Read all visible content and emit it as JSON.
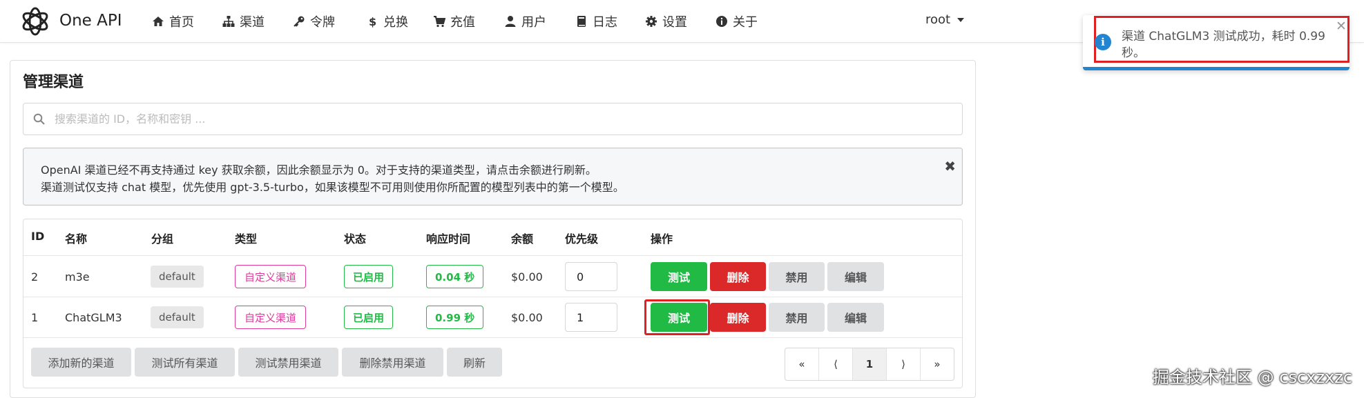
{
  "brand": {
    "name": "One API"
  },
  "nav": {
    "items": [
      {
        "label": "首页",
        "icon": "home-icon"
      },
      {
        "label": "渠道",
        "icon": "sitemap-icon"
      },
      {
        "label": "令牌",
        "icon": "key-icon"
      },
      {
        "label": "兑换",
        "icon": "dollar-icon"
      },
      {
        "label": "充值",
        "icon": "cart-icon"
      },
      {
        "label": "用户",
        "icon": "user-icon"
      },
      {
        "label": "日志",
        "icon": "book-icon"
      },
      {
        "label": "设置",
        "icon": "gear-icon"
      },
      {
        "label": "关于",
        "icon": "info-circle-icon"
      }
    ],
    "user": "root"
  },
  "page": {
    "title": "管理渠道",
    "search_placeholder": "搜索渠道的 ID，名称和密钥 ...",
    "notice": {
      "line1": "OpenAI 渠道已经不再支持通过 key 获取余额，因此余额显示为 0。对于支持的渠道类型，请点击余额进行刷新。",
      "line2": "渠道测试仅支持 chat 模型，优先使用 gpt-3.5-turbo，如果该模型不可用则使用你所配置的模型列表中的第一个模型。",
      "close": "✖"
    }
  },
  "table": {
    "headers": [
      "ID",
      "名称",
      "分组",
      "类型",
      "状态",
      "响应时间",
      "余额",
      "优先级",
      "操作"
    ],
    "rows": [
      {
        "id": "2",
        "name": "m3e",
        "group": "default",
        "type": "自定义渠道",
        "status": "已启用",
        "response": "0.04 秒",
        "balance": "$0.00",
        "priority": "0"
      },
      {
        "id": "1",
        "name": "ChatGLM3",
        "group": "default",
        "type": "自定义渠道",
        "status": "已启用",
        "response": "0.99 秒",
        "balance": "$0.00",
        "priority": "1"
      }
    ],
    "actions": {
      "test": "测试",
      "delete": "删除",
      "disable": "禁用",
      "edit": "编辑"
    }
  },
  "footer_buttons": {
    "add": "添加新的渠道",
    "test_all": "测试所有渠道",
    "test_disabled": "测试禁用渠道",
    "delete_disabled": "删除禁用渠道",
    "refresh": "刷新"
  },
  "pagination": {
    "first": "«",
    "prev": "⟨",
    "current": "1",
    "next": "⟩",
    "last": "»"
  },
  "toast": {
    "line1": "渠道 ChatGLM3 测试成功，耗时 0.99",
    "line2": "秒。",
    "icon": "i",
    "close": "✕"
  },
  "watermark": "掘金技术社区 @ cscxzxzc",
  "colors": {
    "green": "#21ba45",
    "red": "#db2828",
    "pink": "#e0399e",
    "blue": "#2185d0",
    "highlight": "#e02020"
  }
}
